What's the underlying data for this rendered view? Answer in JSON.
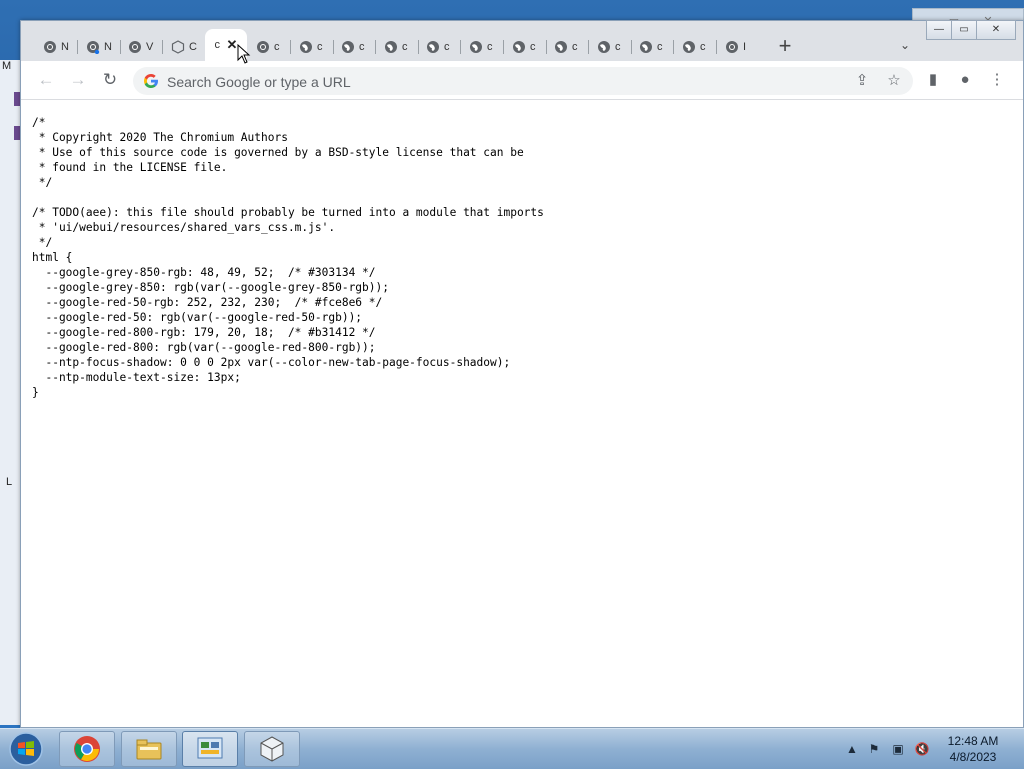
{
  "desktop": {
    "left_letters": [
      "M",
      "L"
    ]
  },
  "tabs": [
    {
      "text": "N",
      "icon": "chrome-icon",
      "active": false
    },
    {
      "text": "N",
      "icon": "chrome-badge-icon",
      "active": false
    },
    {
      "text": "V",
      "icon": "chrome-icon",
      "active": false
    },
    {
      "text": "C",
      "icon": "extension-icon",
      "active": false
    },
    {
      "text": "c",
      "icon": "none",
      "active": true
    },
    {
      "text": "c",
      "icon": "chrome-icon",
      "active": false
    },
    {
      "text": "c",
      "icon": "globe-icon",
      "active": false
    },
    {
      "text": "c",
      "icon": "globe-icon",
      "active": false
    },
    {
      "text": "c",
      "icon": "globe-icon",
      "active": false
    },
    {
      "text": "c",
      "icon": "globe-icon",
      "active": false
    },
    {
      "text": "c",
      "icon": "globe-icon",
      "active": false
    },
    {
      "text": "c",
      "icon": "globe-icon",
      "active": false
    },
    {
      "text": "c",
      "icon": "globe-icon",
      "active": false
    },
    {
      "text": "c",
      "icon": "globe-icon",
      "active": false
    },
    {
      "text": "c",
      "icon": "globe-icon",
      "active": false
    },
    {
      "text": "c",
      "icon": "globe-icon",
      "active": false
    },
    {
      "text": "I",
      "icon": "chrome-icon",
      "active": false
    }
  ],
  "tabstrip": {
    "new_tab": "+",
    "tab_search": "⌄"
  },
  "window_controls": {
    "minimize": "—",
    "maximize": "▭",
    "close": "✕"
  },
  "toolbar": {
    "back": "←",
    "forward": "→",
    "reload": "↻",
    "omnibox_placeholder": "Search Google or type a URL",
    "share": "⇪",
    "bookmark": "☆",
    "side_panel": "▮",
    "profile": "●",
    "menu": "⋮"
  },
  "code": {
    "lines": [
      "/*",
      " * Copyright 2020 The Chromium Authors",
      " * Use of this source code is governed by a BSD-style license that can be",
      " * found in the LICENSE file.",
      " */",
      "",
      "/* TODO(aee): this file should probably be turned into a module that imports",
      " * 'ui/webui/resources/shared_vars_css.m.js'.",
      " */",
      "html {",
      "  --google-grey-850-rgb: 48, 49, 52;  /* #303134 */",
      "  --google-grey-850: rgb(var(--google-grey-850-rgb));",
      "  --google-red-50-rgb: 252, 232, 230;  /* #fce8e6 */",
      "  --google-red-50: rgb(var(--google-red-50-rgb));",
      "  --google-red-800-rgb: 179, 20, 18;  /* #b31412 */",
      "  --google-red-800: rgb(var(--google-red-800-rgb));",
      "  --ntp-focus-shadow: 0 0 0 2px var(--color-new-tab-page-focus-shadow);",
      "  --ntp-module-text-size: 13px;",
      "}"
    ]
  },
  "taskbar": {
    "apps": [
      {
        "name": "chrome",
        "active": false
      },
      {
        "name": "file-explorer",
        "active": false
      },
      {
        "name": "control-panel",
        "active": true
      },
      {
        "name": "package",
        "active": false
      }
    ],
    "tray": {
      "show_hidden": "▲",
      "flag": "⚑",
      "network": "▣",
      "volume": "🔇"
    },
    "time": "12:48 AM",
    "date": "4/8/2023"
  },
  "colors": {
    "tabstrip_bg": "#dee1e6",
    "omnibox_bg": "#f1f3f4",
    "taskbar_top": "#b7cde3"
  }
}
